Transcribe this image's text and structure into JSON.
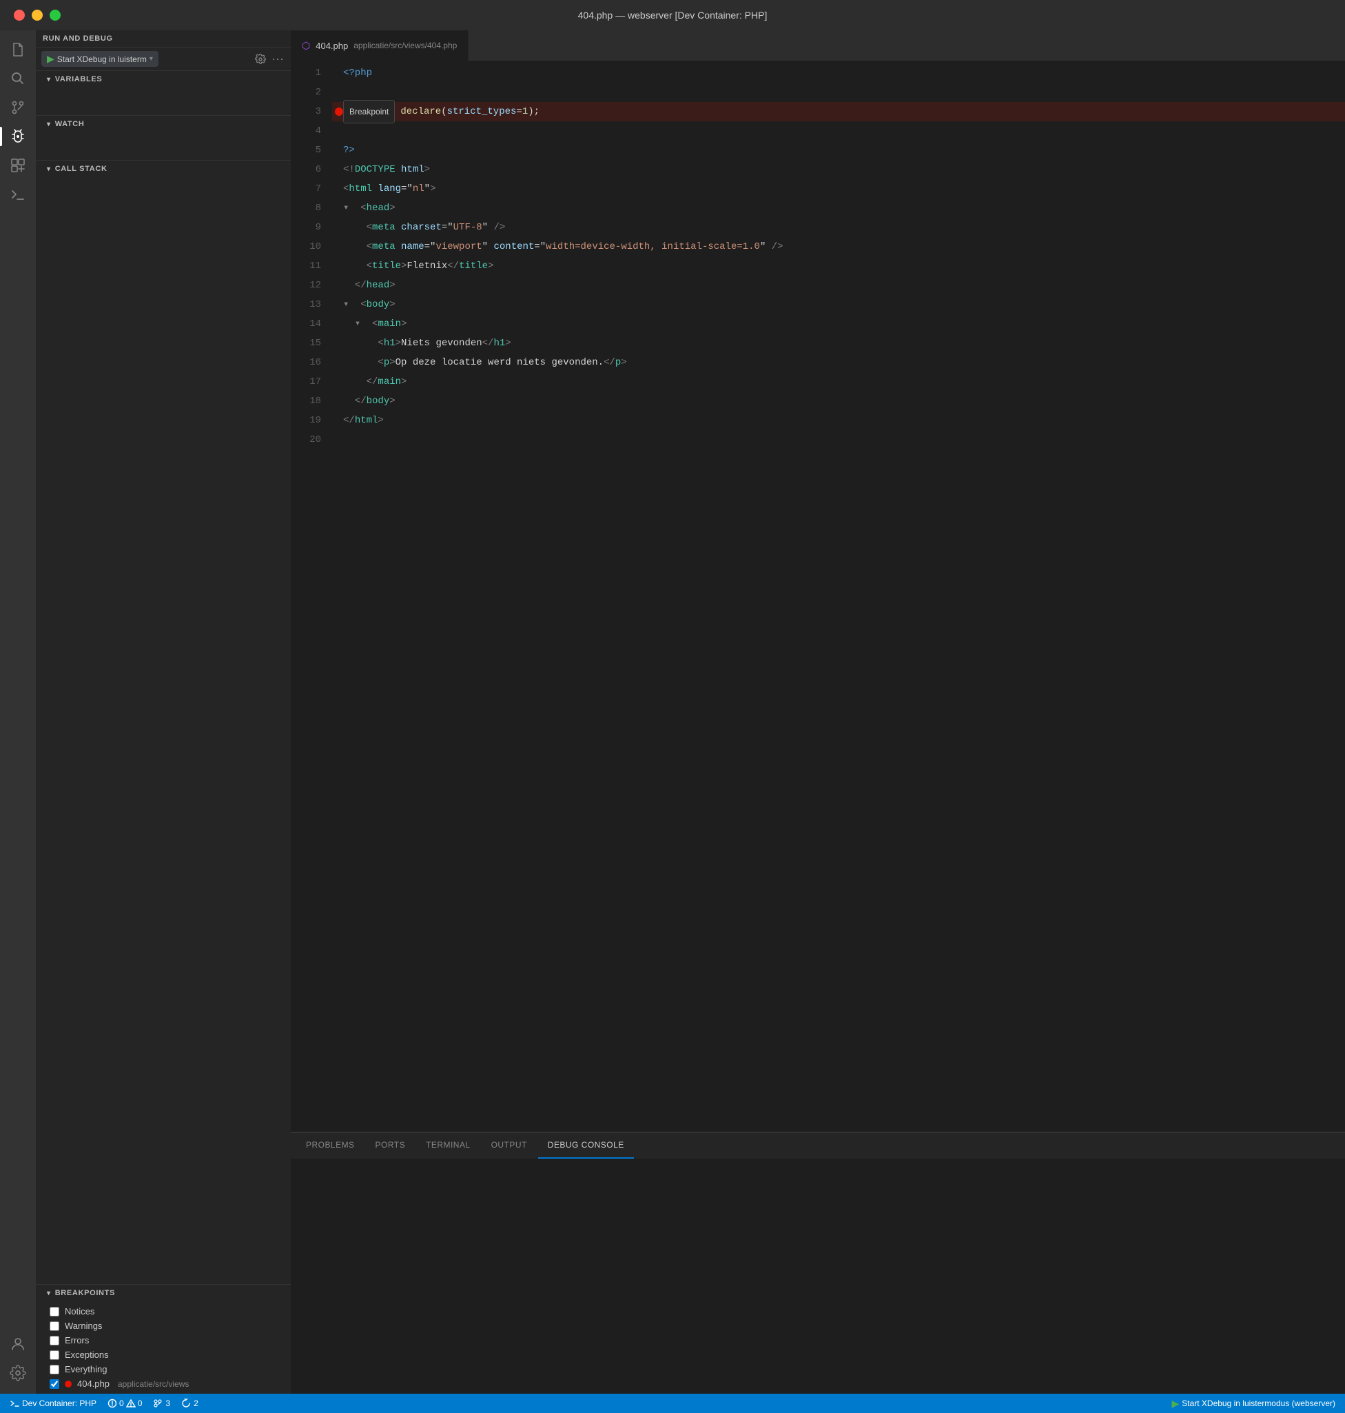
{
  "titlebar": {
    "title": "404.php — webserver [Dev Container: PHP]"
  },
  "activityBar": {
    "icons": [
      {
        "name": "explorer-icon",
        "symbol": "⎘",
        "active": false
      },
      {
        "name": "search-icon",
        "symbol": "🔍",
        "active": false
      },
      {
        "name": "source-control-icon",
        "symbol": "⑂",
        "active": false
      },
      {
        "name": "debug-icon",
        "symbol": "▷",
        "active": true
      },
      {
        "name": "extensions-icon",
        "symbol": "⊞",
        "active": false
      },
      {
        "name": "remote-icon",
        "symbol": "⊏",
        "active": false
      }
    ],
    "bottomIcons": [
      {
        "name": "account-icon",
        "symbol": "👤",
        "active": false
      },
      {
        "name": "settings-icon",
        "symbol": "⚙",
        "active": false
      }
    ]
  },
  "debugPanel": {
    "runConfig": "Start XDebug in luisterm",
    "sections": {
      "variables": {
        "label": "VARIABLES"
      },
      "watch": {
        "label": "WATCH"
      },
      "callStack": {
        "label": "CALL STACK"
      },
      "breakpoints": {
        "label": "BREAKPOINTS"
      }
    },
    "breakpoints": [
      {
        "id": "notices",
        "label": "Notices",
        "checked": false
      },
      {
        "id": "warnings",
        "label": "Warnings",
        "checked": false
      },
      {
        "id": "errors",
        "label": "Errors",
        "checked": false
      },
      {
        "id": "exceptions",
        "label": "Exceptions",
        "checked": false
      },
      {
        "id": "everything",
        "label": "Everything",
        "checked": false
      },
      {
        "id": "404php",
        "label": "404.php",
        "path": "applicatie/src/views",
        "checked": true,
        "hasDot": true
      }
    ]
  },
  "editor": {
    "tabIcon": "🔮",
    "tabFilename": "404.php",
    "tabPath": "applicatie/src/views/404.php",
    "breakpointTooltip": "Breakpoint",
    "lines": [
      {
        "num": 1,
        "tokens": [
          {
            "t": "php-tag",
            "v": "<?php"
          }
        ]
      },
      {
        "num": 2,
        "tokens": []
      },
      {
        "num": 3,
        "tokens": [
          {
            "t": "function-call",
            "v": "declare"
          },
          {
            "t": "punct",
            "v": "("
          },
          {
            "t": "attr-name",
            "v": "strict_types"
          },
          {
            "t": "punct",
            "v": "="
          },
          {
            "t": "number",
            "v": "1"
          },
          {
            "t": "punct",
            "v": ");"
          }
        ],
        "breakpoint": true
      },
      {
        "num": 4,
        "tokens": []
      },
      {
        "num": 5,
        "tokens": [
          {
            "t": "php-tag",
            "v": "?>"
          }
        ]
      },
      {
        "num": 6,
        "tokens": [
          {
            "t": "html-bracket",
            "v": "<!"
          },
          {
            "t": "html-tag",
            "v": "DOCTYPE"
          },
          {
            "t": "text-content",
            "v": " "
          },
          {
            "t": "attr-name",
            "v": "html"
          },
          {
            "t": "html-bracket",
            "v": ">"
          }
        ]
      },
      {
        "num": 7,
        "tokens": [
          {
            "t": "html-bracket",
            "v": "<"
          },
          {
            "t": "html-tag",
            "v": "html"
          },
          {
            "t": "text-content",
            "v": " "
          },
          {
            "t": "attr-name",
            "v": "lang"
          },
          {
            "t": "punct",
            "v": "=\""
          },
          {
            "t": "attr-val",
            "v": "nl"
          },
          {
            "t": "punct",
            "v": "\""
          },
          {
            "t": "html-bracket",
            "v": ">"
          }
        ]
      },
      {
        "num": 8,
        "tokens": [
          {
            "t": "fold",
            "v": "▾"
          },
          {
            "t": "html-bracket",
            "v": "  <"
          },
          {
            "t": "html-tag",
            "v": "head"
          },
          {
            "t": "html-bracket",
            "v": ">"
          }
        ]
      },
      {
        "num": 9,
        "tokens": [
          {
            "t": "html-bracket",
            "v": "    <"
          },
          {
            "t": "html-tag",
            "v": "meta"
          },
          {
            "t": "text-content",
            "v": " "
          },
          {
            "t": "attr-name",
            "v": "charset"
          },
          {
            "t": "punct",
            "v": "=\""
          },
          {
            "t": "attr-val",
            "v": "UTF-8"
          },
          {
            "t": "punct",
            "v": "\""
          },
          {
            "t": "html-bracket",
            "v": " />"
          }
        ]
      },
      {
        "num": 10,
        "tokens": [
          {
            "t": "html-bracket",
            "v": "    <"
          },
          {
            "t": "html-tag",
            "v": "meta"
          },
          {
            "t": "text-content",
            "v": " "
          },
          {
            "t": "attr-name",
            "v": "name"
          },
          {
            "t": "punct",
            "v": "=\""
          },
          {
            "t": "attr-val",
            "v": "viewport"
          },
          {
            "t": "punct",
            "v": "\""
          },
          {
            "t": "text-content",
            "v": " "
          },
          {
            "t": "attr-name",
            "v": "content"
          },
          {
            "t": "punct",
            "v": "=\""
          },
          {
            "t": "attr-val",
            "v": "width=device-width, initial-scale=1.0"
          },
          {
            "t": "punct",
            "v": "\""
          },
          {
            "t": "html-bracket",
            "v": " />"
          }
        ]
      },
      {
        "num": 11,
        "tokens": [
          {
            "t": "html-bracket",
            "v": "    <"
          },
          {
            "t": "html-tag",
            "v": "title"
          },
          {
            "t": "html-bracket",
            "v": ">"
          },
          {
            "t": "text-content",
            "v": "Fletnix"
          },
          {
            "t": "html-bracket",
            "v": "</"
          },
          {
            "t": "html-tag",
            "v": "title"
          },
          {
            "t": "html-bracket",
            "v": ">"
          }
        ]
      },
      {
        "num": 12,
        "tokens": [
          {
            "t": "html-bracket",
            "v": "  </"
          },
          {
            "t": "html-tag",
            "v": "head"
          },
          {
            "t": "html-bracket",
            "v": ">"
          }
        ]
      },
      {
        "num": 13,
        "tokens": [
          {
            "t": "fold",
            "v": "▾"
          },
          {
            "t": "html-bracket",
            "v": "  <"
          },
          {
            "t": "html-tag",
            "v": "body"
          },
          {
            "t": "html-bracket",
            "v": ">"
          }
        ]
      },
      {
        "num": 14,
        "tokens": [
          {
            "t": "fold",
            "v": "  ▾"
          },
          {
            "t": "html-bracket",
            "v": "  <"
          },
          {
            "t": "html-tag",
            "v": "main"
          },
          {
            "t": "html-bracket",
            "v": ">"
          }
        ]
      },
      {
        "num": 15,
        "tokens": [
          {
            "t": "html-bracket",
            "v": "      <"
          },
          {
            "t": "html-tag",
            "v": "h1"
          },
          {
            "t": "html-bracket",
            "v": ">"
          },
          {
            "t": "text-content",
            "v": "Niets gevonden"
          },
          {
            "t": "html-bracket",
            "v": "</"
          },
          {
            "t": "html-tag",
            "v": "h1"
          },
          {
            "t": "html-bracket",
            "v": ">"
          }
        ]
      },
      {
        "num": 16,
        "tokens": [
          {
            "t": "html-bracket",
            "v": "      <"
          },
          {
            "t": "html-tag",
            "v": "p"
          },
          {
            "t": "html-bracket",
            "v": ">"
          },
          {
            "t": "text-content",
            "v": "Op deze locatie werd niets gevonden."
          },
          {
            "t": "html-bracket",
            "v": "</"
          },
          {
            "t": "html-tag",
            "v": "p"
          },
          {
            "t": "html-bracket",
            "v": ">"
          }
        ]
      },
      {
        "num": 17,
        "tokens": [
          {
            "t": "html-bracket",
            "v": "    </"
          },
          {
            "t": "html-tag",
            "v": "main"
          },
          {
            "t": "html-bracket",
            "v": ">"
          }
        ]
      },
      {
        "num": 18,
        "tokens": [
          {
            "t": "html-bracket",
            "v": "  </"
          },
          {
            "t": "html-tag",
            "v": "body"
          },
          {
            "t": "html-bracket",
            "v": ">"
          }
        ]
      },
      {
        "num": 19,
        "tokens": [
          {
            "t": "html-bracket",
            "v": "</"
          },
          {
            "t": "html-tag",
            "v": "html"
          },
          {
            "t": "html-bracket",
            "v": ">"
          }
        ]
      },
      {
        "num": 20,
        "tokens": []
      }
    ]
  },
  "bottomPanel": {
    "tabs": [
      {
        "id": "problems",
        "label": "PROBLEMS"
      },
      {
        "id": "ports",
        "label": "PORTS"
      },
      {
        "id": "terminal",
        "label": "TERMINAL"
      },
      {
        "id": "output",
        "label": "OUTPUT"
      },
      {
        "id": "debug-console",
        "label": "DEBUG CONSOLE",
        "active": true
      }
    ]
  },
  "statusBar": {
    "left": [
      {
        "id": "remote",
        "text": "Dev Container: PHP",
        "icon": "⊏"
      },
      {
        "id": "debug-active",
        "text": "Start XDebug in luistermodus (webserver)",
        "icon": "▷"
      }
    ],
    "errors": {
      "count": "0",
      "warnings": "0"
    },
    "right": [
      {
        "id": "git-branch",
        "text": "3"
      },
      {
        "id": "sync",
        "text": "2"
      }
    ]
  }
}
